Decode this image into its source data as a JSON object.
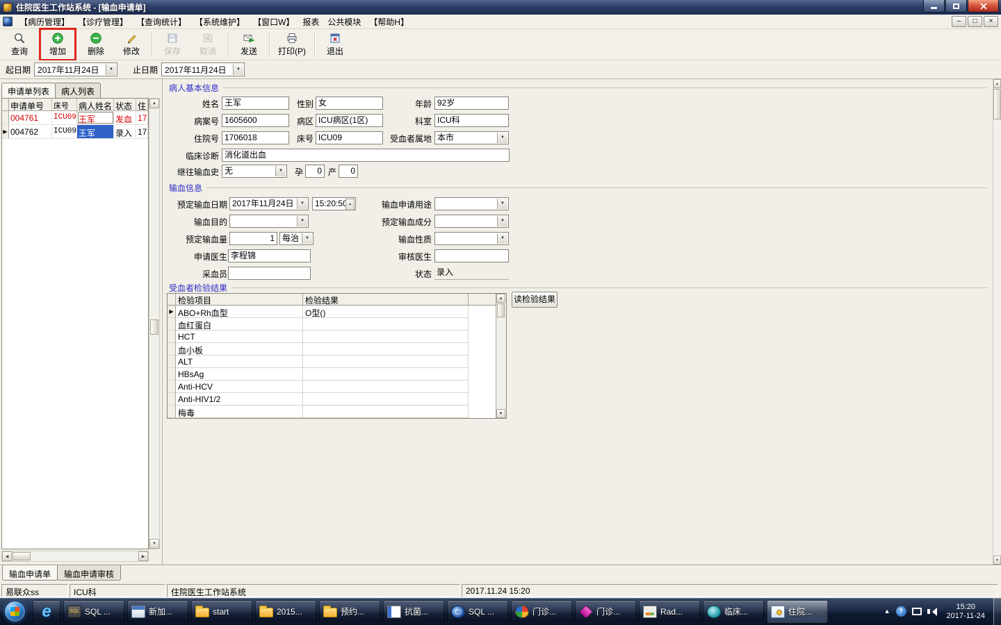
{
  "titlebar": {
    "title": "住院医生工作站系统 - [输血申请单]"
  },
  "menubar": {
    "items": [
      "【病历管理】",
      "【诊疗管理】",
      "【查询统计】",
      "【系统维护】",
      "【窗口W】",
      "报表",
      "公共模块",
      "【帮助H】"
    ]
  },
  "toolbar": {
    "highlight_color": "#e1251b",
    "buttons": [
      {
        "label": "查询"
      },
      {
        "label": "增加"
      },
      {
        "label": "删除"
      },
      {
        "label": "修改"
      },
      {
        "label": "保存"
      },
      {
        "label": "取消"
      },
      {
        "label": "发送"
      },
      {
        "label": "打印(P)"
      },
      {
        "label": "退出"
      }
    ]
  },
  "date_filter": {
    "start_label": "起日期",
    "start_value": "2017年11月24日",
    "end_label": "止日期",
    "end_value": "2017年11月24日"
  },
  "left_panel": {
    "tabs": [
      {
        "label": "申请单列表"
      },
      {
        "label": "病人列表"
      }
    ],
    "grid": {
      "headers": [
        "申请单号",
        "床号",
        "病人姓名",
        "状态",
        "住"
      ],
      "rows": [
        {
          "no": "004761",
          "bed": "ICU09",
          "name": "王军",
          "status": "发血",
          "col5": "17"
        },
        {
          "no": "004762",
          "bed": "ICU09",
          "name": "王军",
          "status": "录入",
          "col5": "17"
        }
      ]
    }
  },
  "patient_info": {
    "title": "病人基本信息",
    "name": {
      "label": "姓名",
      "value": "王军"
    },
    "gender": {
      "label": "性别",
      "value": "女"
    },
    "age": {
      "label": "年龄",
      "value": "92岁"
    },
    "record_no": {
      "label": "病案号",
      "value": "1605600"
    },
    "ward": {
      "label": "病区",
      "value": "ICU病区(1区)"
    },
    "dept": {
      "label": "科室",
      "value": "ICU科"
    },
    "admission_no": {
      "label": "住院号",
      "value": "1706018"
    },
    "bed": {
      "label": "床号",
      "value": "ICU09"
    },
    "locale": {
      "label": "受血者属地",
      "value": "本市"
    },
    "diagnosis": {
      "label": "临床诊断",
      "value": "消化道出血"
    },
    "history": {
      "label": "继往输血史",
      "value": "无"
    },
    "pregnancy": {
      "label": "孕",
      "value": "0"
    },
    "birth": {
      "label": "产",
      "value": "0"
    }
  },
  "transfusion_info": {
    "title": "输血信息",
    "date": {
      "label": "预定输血日期",
      "value": "2017年11月24日"
    },
    "time": {
      "value": "15:20:50"
    },
    "purpose": {
      "label": "输血申请用途",
      "value": ""
    },
    "goal": {
      "label": "输血目的",
      "value": ""
    },
    "component": {
      "label": "预定输血成分",
      "value": ""
    },
    "amount": {
      "label": "预定输血量",
      "value": "1"
    },
    "unit": {
      "value": "每治"
    },
    "nature": {
      "label": "输血性质",
      "value": ""
    },
    "doctor": {
      "label": "申请医生",
      "value": "李程锦"
    },
    "reviewer": {
      "label": "审核医生",
      "value": ""
    },
    "collector": {
      "label": "采血员",
      "value": ""
    },
    "status": {
      "label": "状态",
      "value": "录入"
    }
  },
  "test_results": {
    "title": "受血者检验结果",
    "headers": [
      "检验项目",
      "检验结果"
    ],
    "read_button": "读检验结果",
    "rows": [
      {
        "indicator": "▶",
        "item": "ABO+Rh血型",
        "result": "O型()"
      },
      {
        "indicator": "",
        "item": "血红蛋白",
        "result": ""
      },
      {
        "indicator": "",
        "item": "HCT",
        "result": ""
      },
      {
        "indicator": "",
        "item": "血小板",
        "result": ""
      },
      {
        "indicator": "",
        "item": "ALT",
        "result": ""
      },
      {
        "indicator": "",
        "item": "HBsAg",
        "result": ""
      },
      {
        "indicator": "",
        "item": "Anti-HCV",
        "result": ""
      },
      {
        "indicator": "",
        "item": "Anti-HIV1/2",
        "result": ""
      },
      {
        "indicator": "",
        "item": "梅毒",
        "result": ""
      }
    ]
  },
  "bottom_tabs": [
    {
      "label": "输血申请单"
    },
    {
      "label": "输血申请审核"
    }
  ],
  "statusbar": {
    "user": "易联众ss",
    "dept": "ICU科",
    "app": "住院医生工作站系统",
    "datetime": "2017.11.24 15:20"
  },
  "taskbar": {
    "items": [
      {
        "label": "SQL ..."
      },
      {
        "label": "新加..."
      },
      {
        "label": "start"
      },
      {
        "label": "2015..."
      },
      {
        "label": "预约..."
      },
      {
        "label": "抗菌..."
      },
      {
        "label": "SQL ..."
      },
      {
        "label": "门诊..."
      },
      {
        "label": "门诊..."
      },
      {
        "label": "Rad..."
      },
      {
        "label": "临床..."
      },
      {
        "label": "住院..."
      }
    ],
    "clock": {
      "time": "15:20",
      "date": "2017-11-24"
    }
  }
}
